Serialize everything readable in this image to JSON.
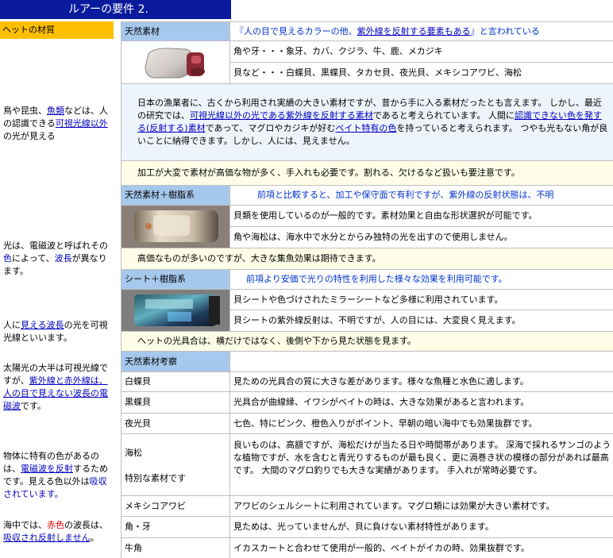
{
  "title": "ルアーの要件 2.",
  "sidebar": {
    "header": "ヘットの材質",
    "p1_a": "鳥や昆虫、",
    "p1_link1": "魚類",
    "p1_b": "などは、人の認識できる",
    "p1_link2": "可視光線以外",
    "p1_c": "の光が見える",
    "p2_a": "光は、電磁波と呼ばれその",
    "p2_link1": "色",
    "p2_b": "によって、",
    "p2_link2": "波長",
    "p2_c": "が異なります。",
    "p3_a": "人に",
    "p3_link": "見える波長",
    "p3_b": "の光を可視光線といいます。",
    "p4_a": "太陽光の大半は可視光線ですが、",
    "p4_link": "紫外線と赤外線は、人の目で見えない波長の電磁波",
    "p4_b": "です。",
    "p5_a": "物体に特有の色があるのは、",
    "p5_link1": "電磁波を反射",
    "p5_b": "するためです。見える色以外は",
    "p5_link2": "吸収されています。",
    "p6_a": "海中では、",
    "p6_red": "赤色",
    "p6_b": "の波長は、",
    "p6_link": "吸収され反射しません",
    "p6_c": "。"
  },
  "section1": {
    "header": "天然素材",
    "note_a": "『人の目で見えるカラーの他、",
    "note_link": "紫外線を反射する要素もある",
    "note_b": "』と言われている",
    "row1": "角や牙・・・象牙、カバ、クジラ、牛、鹿、メカジキ",
    "row2": "貝など・・・白蝶貝、黒蝶貝、タカセ貝、夜光貝、メキシコアワビ、海松",
    "para_a": "日本の漁業者に、古くから利用され実績の大きい素材ですが、昔から手に入る素材だったとも言えます。 しかし、最近の研究では、",
    "para_link1": "可視光線以外の光である紫外線を反射する素材",
    "para_b": "であると考えられています。 人間に",
    "para_link2": "認識できない色を発する(反射する)素材",
    "para_c": "であって、マグロやカジキが好む",
    "para_link3": "ベイト特有の色",
    "para_d": "を持っていると考えられます。 つやも光もない角が良いことに納得できます。しかし、人には、見えません。",
    "caution": "加工が大変で素材が高価な物が多く、手入れも必要です。割れる、欠けるなど扱いも要注意です。"
  },
  "section2": {
    "header": "天然素材＋樹脂系",
    "note": "前項と比較すると、加工や保守面で有利ですが、紫外線の反射状態は、不明",
    "row1": "貝類を使用しているのが一般的です。素材効果と自由な形状選択が可能です。",
    "row2": "角や海松は、海水中で水分とからみ独特の光を出すので使用しません。",
    "row3": "高価なものが多いのですが、大きな集魚効果は期待できます。"
  },
  "section3": {
    "header": "シート＋樹脂系",
    "note": "前項より安価で光りの特性を利用した様々な効果を利用可能です。",
    "row1": "貝シートや色づけされたミラーシートなど多様に利用されています。",
    "row2": "貝シートの紫外線反射は、不明ですが、人の目には、大変良く見えます。",
    "row3": "ヘットの光具合は、横だけではなく、後側や下から見た状態を見ます。"
  },
  "section4": {
    "header": "天然素材考察",
    "rows": [
      {
        "name": "白蝶貝",
        "desc": "見ための光具合の質に大きな差があります。様々な魚種と水色に適します。"
      },
      {
        "name": "黒蝶貝",
        "desc": "光具合が曲線縁、イワシがベイトの時は、大きな効果があると言われます。"
      },
      {
        "name": "夜光貝",
        "desc": "七色、特にピンク、橙色入りがポイント、早朝の暗い海中でも効果抜群です。"
      },
      {
        "name": "海松",
        "name2": "特別な素材です",
        "desc": "良いものは、高額ですが、海松だけが当たる日や時間帯があります。 深海で採れるサンゴのような植物ですが、水を含むと青光りするものが最も良く、更に渦巻き状の模様の部分があれば最高です。 大間のマグロ釣りでも大きな実績があります。 手入れが常時必要です。"
      },
      {
        "name": "メキシコアワビ",
        "desc": "アワビのシェルシートに利用されています。マグロ類には効果が大きい素材です。"
      },
      {
        "name": "角・牙",
        "desc": "見ためは、光っていませんが、貝に負けない素材特性があります。"
      },
      {
        "name": "牛角",
        "desc": "イカスカートと合わせて使用が一般的、ベイトがイカの時、効果抜群です。"
      }
    ]
  }
}
